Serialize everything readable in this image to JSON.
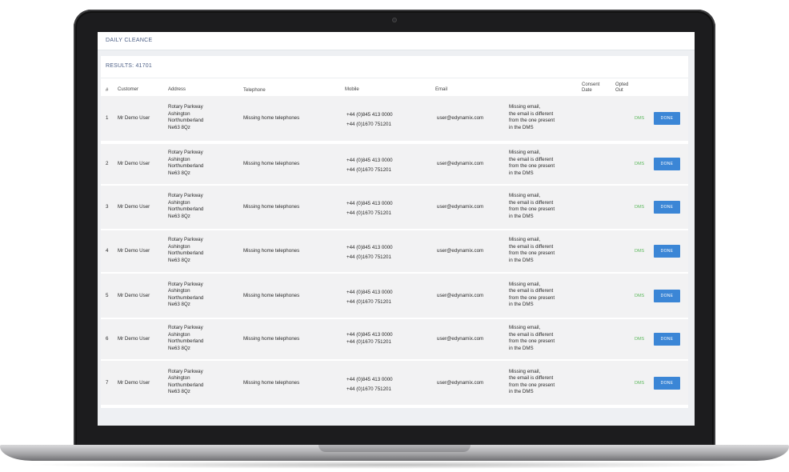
{
  "header": {
    "title": "DAILY CLEANCE"
  },
  "results": {
    "label": "RESULTS: 41701"
  },
  "columns": [
    "#",
    "Customer",
    "Address",
    "Telephone",
    "Mobile",
    "Email",
    "Consent Date",
    "Opted Out",
    ""
  ],
  "rows": [
    {
      "num": "1",
      "customer": "Mr Demo User",
      "address": [
        "Rotary Parkway",
        "Ashington",
        "Northumberland",
        "Ne63 8Qz"
      ],
      "telephone": "Missing home telephones",
      "mobile": [
        "+44 (0)845 413 0000",
        "+44 (0)1670 751201"
      ],
      "email": "user@edynamix.com",
      "note": [
        "Missing email,",
        "the email is different",
        "from the one present",
        "in the DMS"
      ],
      "status": "DMS",
      "button": "DONE"
    },
    {
      "num": "2",
      "customer": "Mr Demo User",
      "address": [
        "Rotary Parkway",
        "Ashington",
        "Northumberland",
        "Ne63 8Qz"
      ],
      "telephone": "Missing home telephones",
      "mobile": [
        "+44 (0)845 413 0000",
        "+44 (0)1670 751201"
      ],
      "email": "user@edynamix.com",
      "note": [
        "Missing email,",
        "the email is different",
        "from the one present",
        "in the DMS"
      ],
      "status": "DMS",
      "button": "DONE"
    },
    {
      "num": "3",
      "customer": "Mr Demo User",
      "address": [
        "Rotary Parkway",
        "Ashington",
        "Northumberland",
        "Ne63 8Qz"
      ],
      "telephone": "Missing home telephones",
      "mobile": [
        "+44 (0)845 413 0000",
        "+44 (0)1670 751201"
      ],
      "email": "user@edynamix.com",
      "note": [
        "Missing email,",
        "the email is different",
        "from the one present",
        "in the DMS"
      ],
      "status": "DMS",
      "button": "DONE"
    },
    {
      "num": "4",
      "customer": "Mr Demo User",
      "address": [
        "Rotary Parkway",
        "Ashington",
        "Northumberland",
        "Ne63 8Qz"
      ],
      "telephone": "Missing home telephones",
      "mobile": [
        "+44 (0)845 413 0000",
        "+44 (0)1670 751201"
      ],
      "email": "user@edynamix.com",
      "note": [
        "Missing email,",
        "the email is different",
        "from the one present",
        "in the DMS"
      ],
      "status": "DMS",
      "button": "DONE"
    },
    {
      "num": "5",
      "customer": "Mr Demo User",
      "address": [
        "Rotary Parkway",
        "Ashington",
        "Northumberland",
        "Ne63 8Qz"
      ],
      "telephone": "Missing home telephones",
      "mobile": [
        "+44 (0)845 413 0000",
        "+44 (0)1670 751201"
      ],
      "email": "user@edynamix.com",
      "note": [
        "Missing email,",
        "the email is different",
        "from the one present",
        "in the DMS"
      ],
      "status": "DMS",
      "button": "DONE"
    },
    {
      "num": "6",
      "customer": "Mr Demo User",
      "address": [
        "Rotary Parkway",
        "Ashington",
        "Northumberland",
        "Ne63 8Qz"
      ],
      "telephone": "Missing home telephones",
      "mobile": [
        "+44 (0)845 413 0000",
        "+44 (0)1670 751201"
      ],
      "email": "user@edynamix.com",
      "note": [
        "Missing email,",
        "the email is different",
        "from the one present",
        "in the DMS"
      ],
      "status": "DMS",
      "button": "DONE"
    },
    {
      "num": "7",
      "customer": "Mr Demo User",
      "address": [
        "Rotary Parkway",
        "Ashington",
        "Northumberland",
        "Ne63 8Qz"
      ],
      "telephone": "Missing home telephones",
      "mobile": [
        "+44 (0)845 413 0000",
        "+44 (0)1670 751201"
      ],
      "email": "user@edynamix.com",
      "note": [
        "Missing email,",
        "the email is different",
        "from the one present",
        "in the DMS"
      ],
      "status": "DMS",
      "button": "DONE"
    }
  ],
  "colors": {
    "accent": "#3b86d6",
    "status": "#5cb85c",
    "header_text": "#4c5f86",
    "row_bg": "#f2f2f3"
  }
}
